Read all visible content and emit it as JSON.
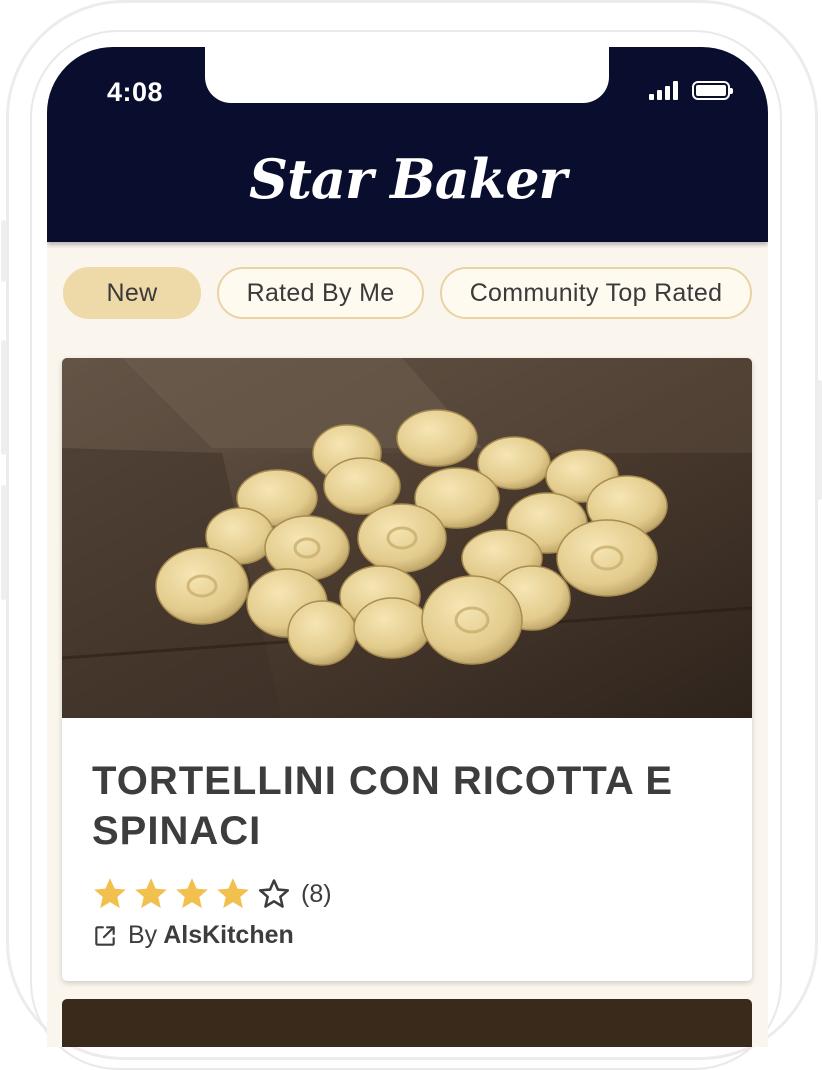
{
  "status_bar": {
    "time": "4:08"
  },
  "app": {
    "title": "Star Baker"
  },
  "tabs": [
    {
      "label": "New",
      "active": true
    },
    {
      "label": "Rated By Me",
      "active": false
    },
    {
      "label": "Community Top Rated",
      "active": false
    }
  ],
  "recipe": {
    "title": "TORTELLINI CON RICOTTA E SPINACI",
    "rating": 4,
    "rating_max": 5,
    "rating_count": "(8)",
    "by_label": "By",
    "author": "AlsKitchen",
    "image": "tortellini-photo"
  },
  "colors": {
    "header_bg": "#0a0e2e",
    "screen_bg": "#faf6ee",
    "tab_active": "#eed9a8",
    "tab_border": "#e8d3a3",
    "star": "#f2c04e",
    "text": "#3d3d3d"
  }
}
